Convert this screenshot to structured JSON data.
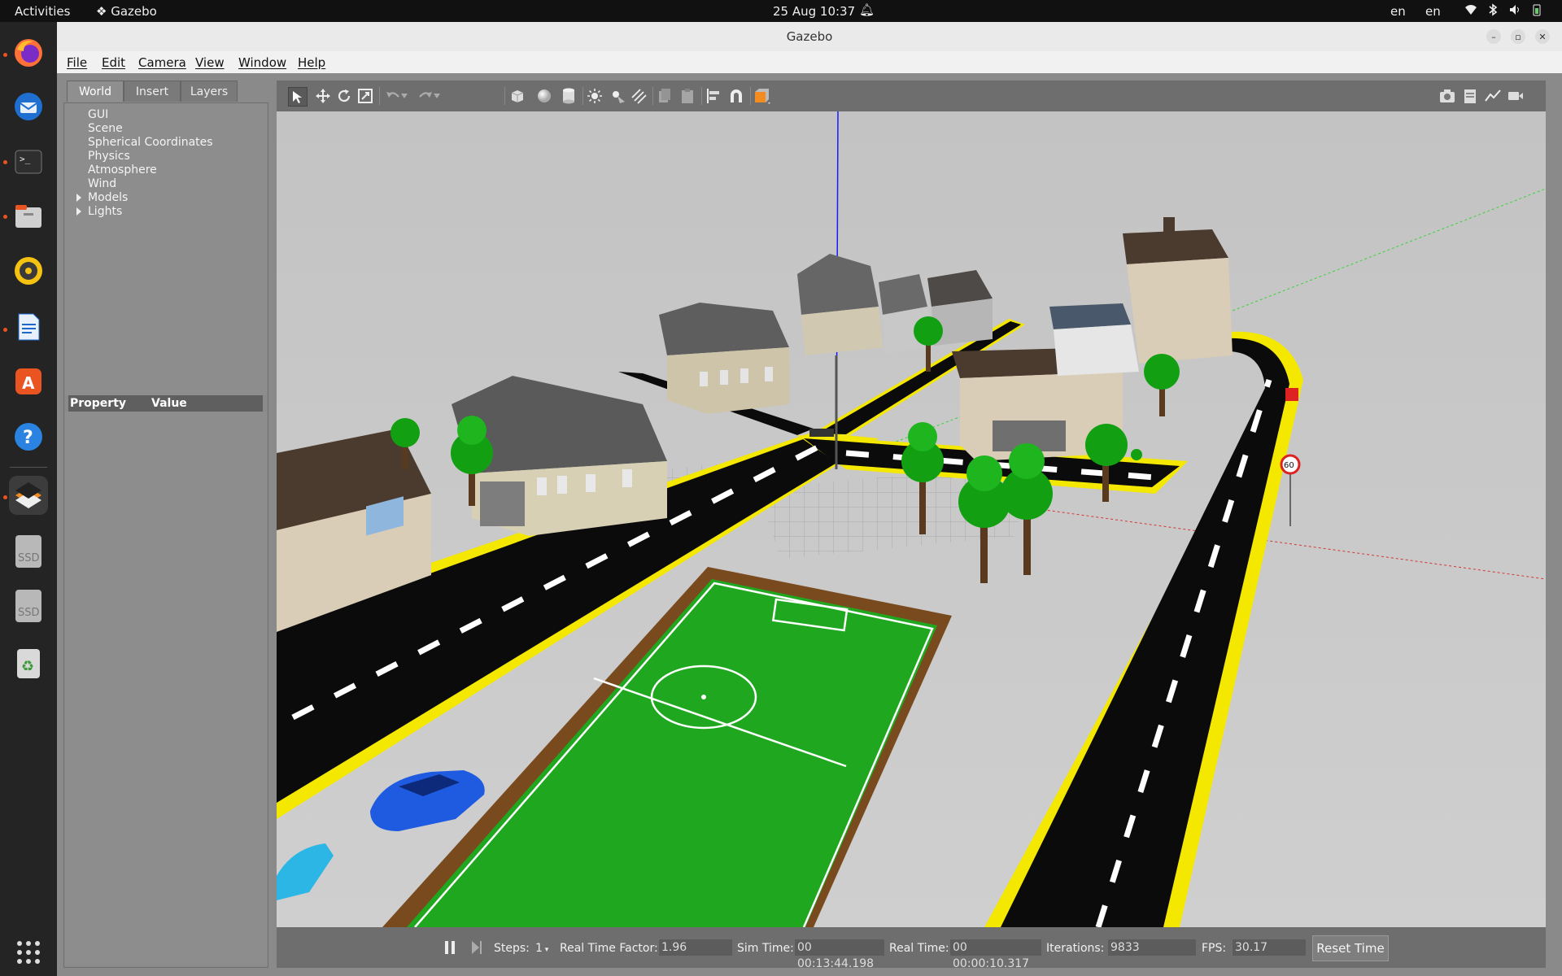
{
  "topbar": {
    "activities": "Activities",
    "app_name": "Gazebo",
    "clock": "25 Aug  10:37",
    "lang1": "en",
    "lang2": "en"
  },
  "dock": {
    "items": [
      "firefox-icon",
      "thunderbird-icon",
      "terminal-icon",
      "files-icon",
      "rhythmbox-icon",
      "writer-icon",
      "app-center-icon",
      "help-icon",
      "gazebo-icon",
      "ssd-drive-icon",
      "ssd-drive-icon",
      "trash-icon"
    ],
    "ssd_label": "SSD"
  },
  "window": {
    "title": "Gazebo",
    "menu": [
      "File",
      "Edit",
      "Camera",
      "View",
      "Window",
      "Help"
    ]
  },
  "left_panel": {
    "tabs": [
      "World",
      "Insert",
      "Layers"
    ],
    "tree": [
      "GUI",
      "Scene",
      "Spherical Coordinates",
      "Physics",
      "Atmosphere",
      "Wind",
      "Models",
      "Lights"
    ],
    "property_header": "Property",
    "value_header": "Value"
  },
  "bottom": {
    "steps_label": "Steps:",
    "steps_value": "1",
    "rtf_label": "Real Time Factor:",
    "rtf_value": "1.96",
    "sim_label": "Sim Time:",
    "sim_value": "00 00:13:44.198",
    "real_label": "Real Time:",
    "real_value": "00 00:00:10.317",
    "iter_label": "Iterations:",
    "iter_value": "9833",
    "fps_label": "FPS:",
    "fps_value": "30.17",
    "reset_label": "Reset Time"
  },
  "scene": {
    "sign_speed": "60"
  },
  "colors": {
    "road": "#0b0b0b",
    "road_edge": "#f5e800",
    "grass": "#1fa81f",
    "ground": "#c9c9c9",
    "accent_orange": "#e95420"
  }
}
